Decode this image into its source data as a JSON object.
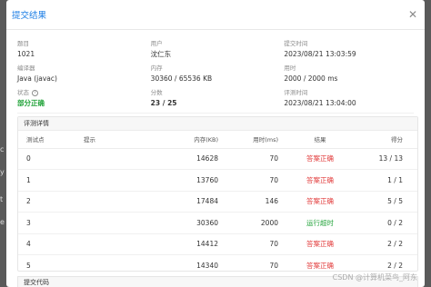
{
  "modal": {
    "title": "提交结果",
    "close_glyph": "✕"
  },
  "info": {
    "problem_label": "题目",
    "problem_value": "1021",
    "user_label": "用户",
    "user_value": "沈仁东",
    "submit_time_label": "提交时间",
    "submit_time_value": "2023/08/21 13:03:59",
    "compiler_label": "编译器",
    "compiler_value": "Java (javac)",
    "memory_label": "内存",
    "memory_value": "30360 / 65536 KB",
    "time_label": "用时",
    "time_value": "2000 / 2000 ms",
    "status_label": "状态",
    "status_value": "部分正确",
    "status_color": "#22a33a",
    "score_label": "分数",
    "score_value": "23 / 25",
    "judge_time_label": "评测时间",
    "judge_time_value": "2023/08/21 13:04:00"
  },
  "judge": {
    "section_title": "评测详情",
    "headers": {
      "case": "测试点",
      "hint": "提示",
      "memory": "内存(KB)",
      "time": "用时(ms)",
      "result": "结果",
      "score": "得分"
    },
    "rows": [
      {
        "case": "0",
        "hint": "",
        "memory": "14628",
        "time": "70",
        "result": "答案正确",
        "score": "13 / 13"
      },
      {
        "case": "1",
        "hint": "",
        "memory": "13760",
        "time": "70",
        "result": "答案正确",
        "score": "1 / 1"
      },
      {
        "case": "2",
        "hint": "",
        "memory": "17484",
        "time": "146",
        "result": "答案正确",
        "score": "5 / 5"
      },
      {
        "case": "3",
        "hint": "",
        "memory": "30360",
        "time": "2000",
        "result": "运行超时",
        "score": "0 / 2"
      },
      {
        "case": "4",
        "hint": "",
        "memory": "14412",
        "time": "70",
        "result": "答案正确",
        "score": "2 / 2"
      },
      {
        "case": "5",
        "hint": "",
        "memory": "14340",
        "time": "70",
        "result": "答案正确",
        "score": "2 / 2"
      }
    ]
  },
  "bottom": {
    "section_title": "提交代码"
  },
  "watermark": "CSDN @计算机菜鸟_阿东",
  "colors": {
    "accent": "#1f7fe5",
    "correct": "#e23b3b",
    "timeout": "#22a33a"
  }
}
